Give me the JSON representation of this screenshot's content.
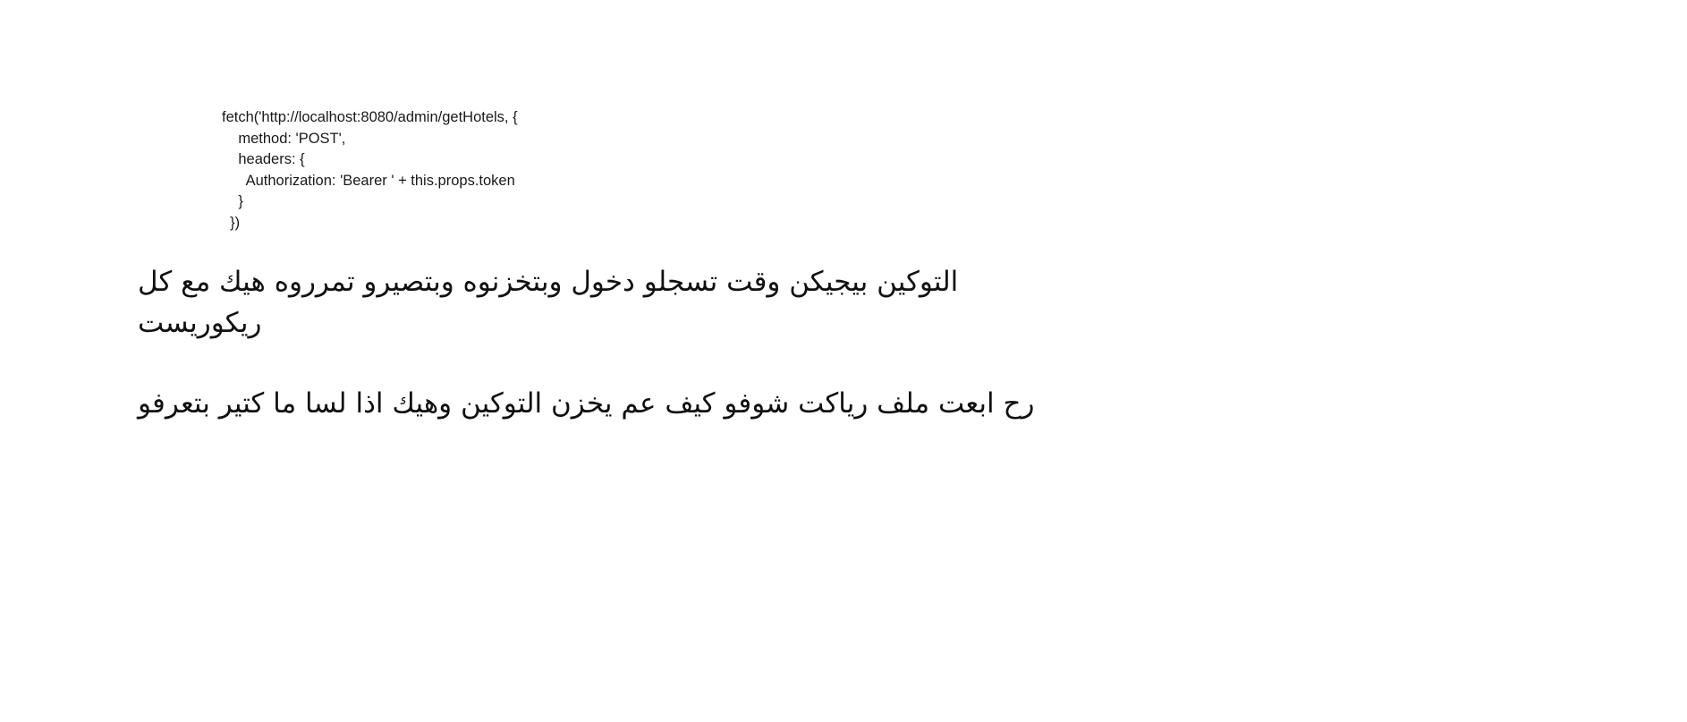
{
  "code_snippet": {
    "lines": [
      "fetch('http://localhost:8080/admin/getHotels, {",
      "    method: 'POST',",
      "    headers: {",
      "      Authorization: 'Bearer ' + this.props.token",
      "    }",
      "  })"
    ]
  },
  "messages": [
    {
      "lines": [
        "التوكين بيجيكن وقت تسجلو دخول وبتخزنوه وبتصيرو تمرروه هيك مع كل",
        "ريكوريست"
      ]
    },
    {
      "lines": [
        "رح ابعت ملف رياكت شوفو كيف عم يخزن التوكين وهيك اذا لسا ما كتير بتعرفو"
      ]
    }
  ]
}
